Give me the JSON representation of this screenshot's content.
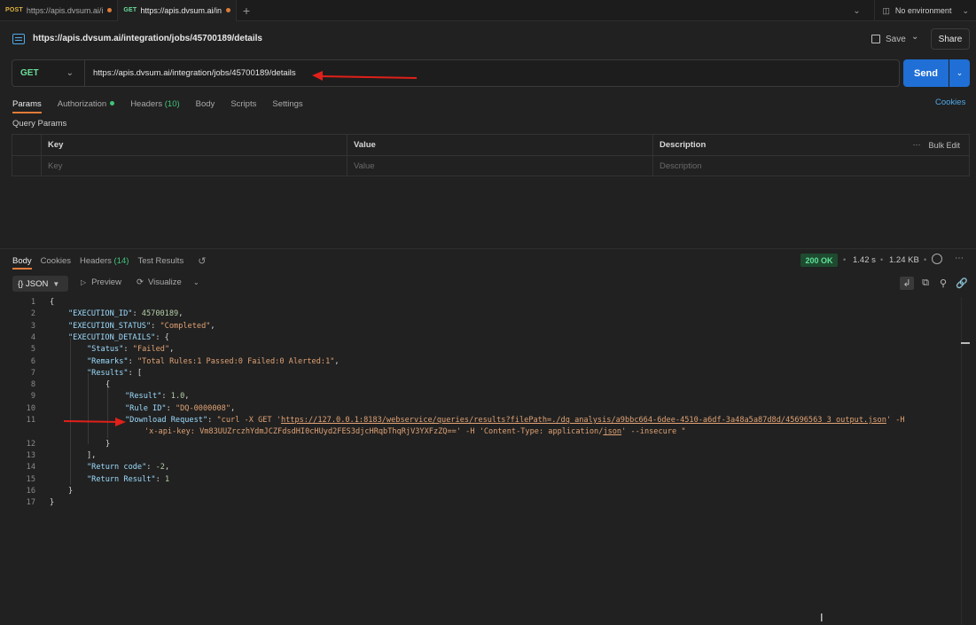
{
  "tabs": [
    {
      "method": "POST",
      "label": "https://apis.dvsum.ai/i",
      "method_color": "#e0b341",
      "active": false
    },
    {
      "method": "GET",
      "label": "https://apis.dvsum.ai/in",
      "method_color": "#6bdd9a",
      "active": true
    }
  ],
  "environment": {
    "label": "No environment"
  },
  "request": {
    "title": "https://apis.dvsum.ai/integration/jobs/45700189/details",
    "method": "GET",
    "url": "https://apis.dvsum.ai/integration/jobs/45700189/details"
  },
  "toolbar": {
    "save_label": "Save",
    "share_label": "Share",
    "send_label": "Send"
  },
  "request_tabs": {
    "params": "Params",
    "authorization": "Authorization",
    "headers": "Headers",
    "headers_count": "(10)",
    "body": "Body",
    "scripts": "Scripts",
    "settings": "Settings",
    "cookies": "Cookies"
  },
  "query_params": {
    "label": "Query Params",
    "headers": [
      "Key",
      "Value",
      "Description"
    ],
    "bulk_edit": "Bulk Edit",
    "placeholders": [
      "Key",
      "Value",
      "Description"
    ]
  },
  "response_tabs": {
    "body": "Body",
    "cookies": "Cookies",
    "headers": "Headers",
    "headers_count": "(14)",
    "test_results": "Test Results"
  },
  "response_meta": {
    "status": "200 OK",
    "time": "1.42 s",
    "size": "1.24 KB"
  },
  "response_toolbar": {
    "format": "{} JSON",
    "preview": "Preview",
    "visualize": "Visualize"
  },
  "code_lines": [
    {
      "n": "1"
    },
    {
      "n": "2"
    },
    {
      "n": "3"
    },
    {
      "n": "4"
    },
    {
      "n": "5"
    },
    {
      "n": "6"
    },
    {
      "n": "7"
    },
    {
      "n": "8"
    },
    {
      "n": "9"
    },
    {
      "n": "10"
    },
    {
      "n": "11"
    },
    {
      "n": "12"
    },
    {
      "n": "13"
    },
    {
      "n": "14"
    },
    {
      "n": "15"
    },
    {
      "n": "16"
    },
    {
      "n": "17"
    }
  ],
  "json_body": {
    "execution_id_key": "\"EXECUTION_ID\"",
    "execution_id_val": "45700189",
    "execution_status_key": "\"EXECUTION_STATUS\"",
    "execution_status_val": "\"Completed\"",
    "execution_details_key": "\"EXECUTION_DETAILS\"",
    "status_key": "\"Status\"",
    "status_val": "\"Failed\"",
    "remarks_key": "\"Remarks\"",
    "remarks_val": "\"Total Rules:1 Passed:0 Failed:0 Alerted:1\"",
    "results_key": "\"Results\"",
    "result_key": "\"Result\"",
    "result_val": "1.0",
    "rule_id_key": "\"Rule ID\"",
    "rule_id_val": "\"DQ-0000008\"",
    "download_key": "\"Download Request\"",
    "download_val_a": "\"curl -X GET '",
    "download_url": "https://127.0.0.1:8183/webservice/queries/results?filePath=./dq_analysis/a9bbc664-6dee-4510-a6df-3a48a5a87d8d/45696563_3_output.json",
    "download_val_b": "' -H",
    "download_val_c": "'x-api-key: Vm83UUZrczhYdmJCZFdsdHI0cHUyd2FES3djcHRqbThqRjV3YXFzZQ==' -H 'Content-Type: application/",
    "download_json": "json",
    "download_val_d": "' --insecure \"",
    "return_code_key": "\"Return code\"",
    "return_code_val": "-2",
    "return_result_key": "\"Return Result\"",
    "return_result_val": "1"
  }
}
